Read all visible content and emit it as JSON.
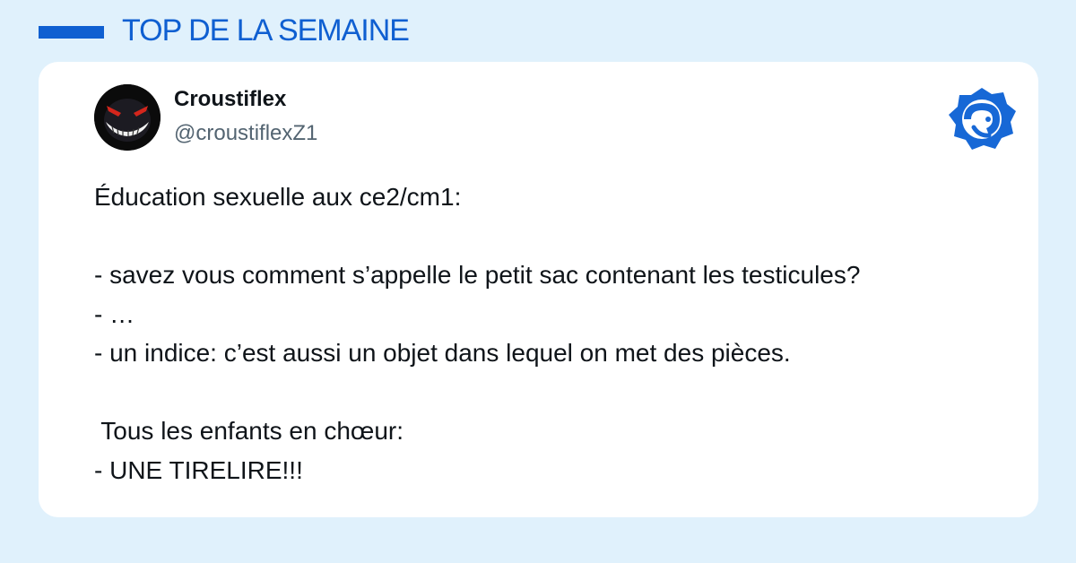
{
  "header": {
    "title": "TOP DE LA SEMAINE",
    "accent_color": "#0f5fd1",
    "background_color": "#e0f1fc"
  },
  "tweet": {
    "author": {
      "name": "Croustiflex",
      "handle": "@croustiflexZ1",
      "avatar_icon": "grinning-ghost-avatar"
    },
    "brand_icon": "blue-badge-logo-icon",
    "lines": [
      "Éducation sexuelle aux ce2/cm1:",
      "",
      "- savez vous comment s’appelle le petit sac contenant les testicules?",
      "- …",
      "- un indice: c’est aussi un objet dans lequel on met des pièces.",
      "",
      " Tous les enfants en chœur:",
      "- UNE TIRELIRE!!!"
    ]
  }
}
